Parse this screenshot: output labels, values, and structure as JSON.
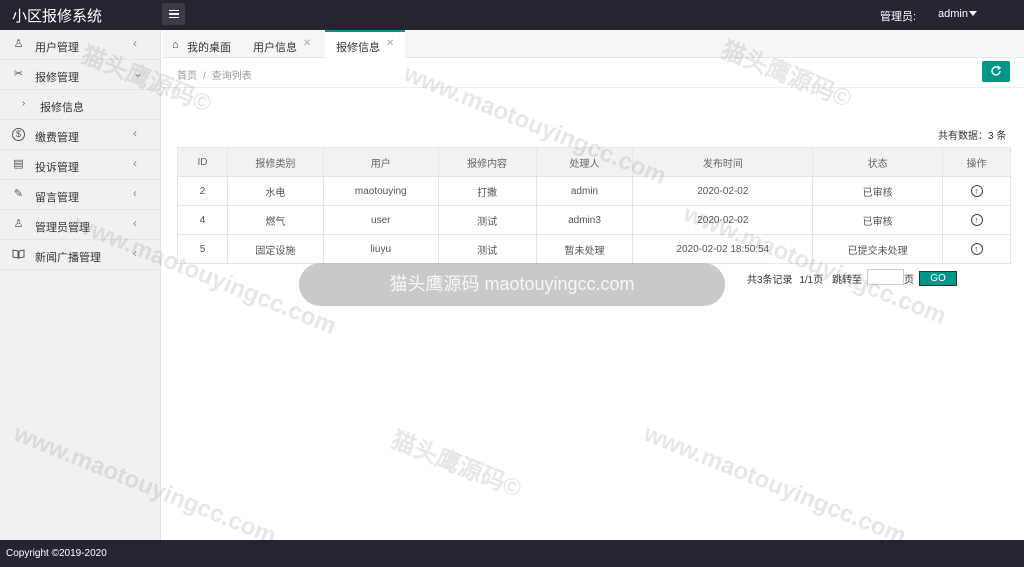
{
  "header": {
    "app_title": "小区报修系统",
    "admin_label": "管理员:",
    "admin_name": "admin"
  },
  "sidebar": {
    "items": [
      {
        "label": "用户管理",
        "icon": "user-icon",
        "glyph": "♙"
      },
      {
        "label": "报修管理",
        "icon": "wrench-icon",
        "glyph": "✂"
      },
      {
        "label": "报修信息",
        "icon": "chevron-right-icon",
        "glyph": "›"
      },
      {
        "label": "缴费管理",
        "icon": "dollar-icon",
        "glyph": "$"
      },
      {
        "label": "投诉管理",
        "icon": "clipboard-icon",
        "glyph": "▤"
      },
      {
        "label": "留言管理",
        "icon": "edit-icon",
        "glyph": "✎"
      },
      {
        "label": "管理员管理",
        "icon": "admin-icon",
        "glyph": "♙"
      },
      {
        "label": "新闻广播管理",
        "icon": "book-icon",
        "glyph": "📖"
      }
    ]
  },
  "tabs": [
    {
      "label": "我的桌面"
    },
    {
      "label": "用户信息"
    },
    {
      "label": "报修信息"
    }
  ],
  "breadcrumb": {
    "home": "首页",
    "separator": "/",
    "current": "查询列表"
  },
  "total_text": "共有数据：3 条",
  "table": {
    "headers": [
      "ID",
      "报修类别",
      "用户",
      "报修内容",
      "处理人",
      "发布时间",
      "状态",
      "操作"
    ],
    "rows": [
      {
        "id": "2",
        "category": "水电",
        "user": "maotouying",
        "content": "打撒",
        "handler": "admin",
        "time": "2020-02-02",
        "status": "已审核"
      },
      {
        "id": "4",
        "category": "燃气",
        "user": "user",
        "content": "测试",
        "handler": "admin3",
        "time": "2020-02-02",
        "status": "已审核"
      },
      {
        "id": "5",
        "category": "固定设施",
        "user": "liuyu",
        "content": "测试",
        "handler": "暂未处理",
        "time": "2020-02-02 18:50:54",
        "status": "已提交未处理"
      }
    ]
  },
  "pager": {
    "records": "共3条记录",
    "pages": "1/1页",
    "jump_label": "跳转至",
    "page_suffix": "页",
    "go_label": "GO"
  },
  "watermark": {
    "pill_text": "猫头鹰源码 maotouyingcc.com",
    "cn": "猫头鹰源码©",
    "url": "www.maotouyingcc.com"
  },
  "footer": {
    "copyright": "Copyright ©2019-2020"
  },
  "colors": {
    "topbar": "#23262e",
    "accent": "#009688",
    "sidebar": "#f1f1f1"
  }
}
